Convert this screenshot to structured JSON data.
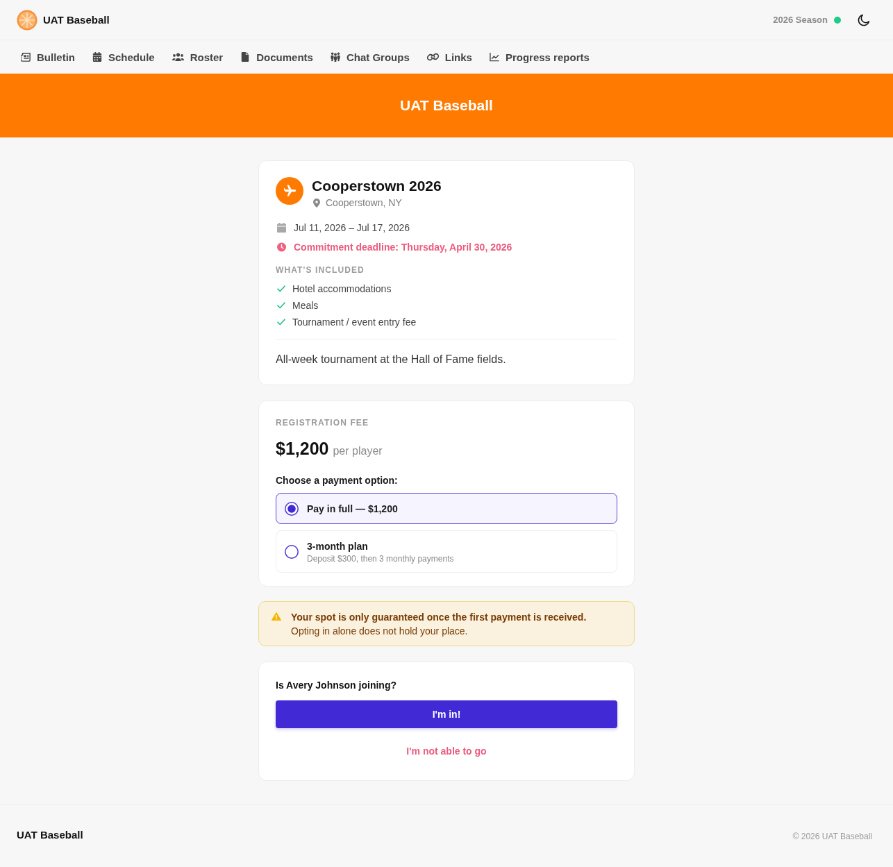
{
  "header": {
    "brand": "UAT Baseball",
    "season": "2026 Season"
  },
  "nav": [
    {
      "label": "Bulletin"
    },
    {
      "label": "Schedule"
    },
    {
      "label": "Roster"
    },
    {
      "label": "Documents"
    },
    {
      "label": "Chat Groups"
    },
    {
      "label": "Links"
    },
    {
      "label": "Progress reports"
    }
  ],
  "banner": {
    "title": "UAT Baseball"
  },
  "event": {
    "title": "Cooperstown 2026",
    "location": "Cooperstown, NY",
    "dates": "Jul 11, 2026 – Jul 17, 2026",
    "deadline": "Commitment deadline: Thursday, April 30, 2026",
    "included_heading": "WHAT'S INCLUDED",
    "included": [
      "Hotel accommodations",
      "Meals",
      "Tournament / event entry fee"
    ],
    "description": "All-week tournament at the Hall of Fame fields."
  },
  "fee": {
    "heading": "REGISTRATION FEE",
    "amount": "$1,200",
    "unit": "per player",
    "prompt": "Choose a payment option:",
    "options": [
      {
        "label": "Pay in full — $1,200",
        "selected": true
      },
      {
        "label": "3-month plan",
        "detail": "Deposit $300, then 3 monthly payments",
        "selected": false
      }
    ]
  },
  "notice": {
    "title": "Your spot is only guaranteed once the first payment is received.",
    "text": "Opting in alone does not hold your place."
  },
  "rsvp": {
    "question": "Is Avery Johnson joining?",
    "buttons": [
      {
        "label": "I'm in!",
        "kind": "primary"
      },
      {
        "label": "I'm not able to go",
        "kind": "decline"
      }
    ]
  },
  "footer": {
    "brand": "UAT Baseball",
    "copyright": "© 2026 UAT Baseball"
  }
}
